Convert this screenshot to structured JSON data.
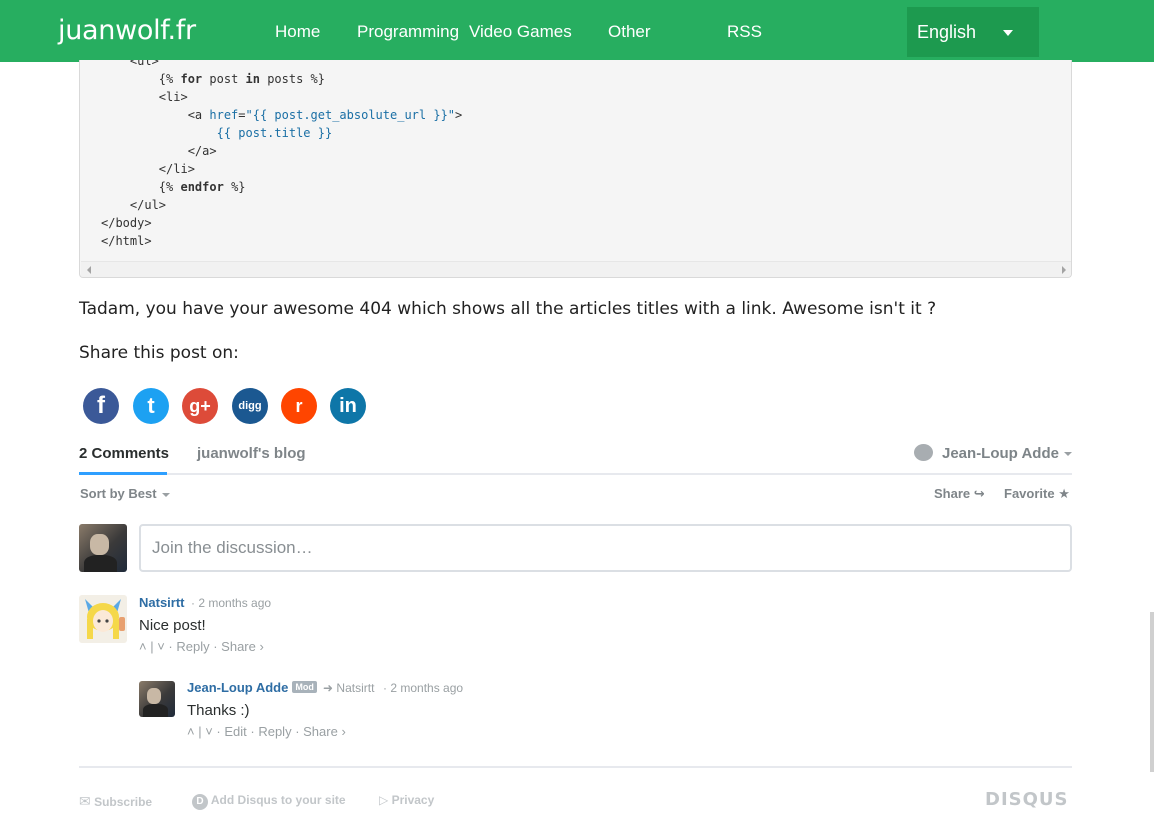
{
  "navbar": {
    "brand": "juanwolf.fr",
    "items": [
      {
        "label": "Home"
      },
      {
        "label": "Programming"
      },
      {
        "label": "Video Games"
      },
      {
        "label": "Other"
      },
      {
        "label": "RSS"
      }
    ],
    "language": "English"
  },
  "code_lines": [
    "    <ul>",
    "        {% for post in posts %}",
    "        <li>",
    "            <a href=\"{{ post.get_absolute_url }}\">",
    "                {{ post.title }}",
    "            </a>",
    "        </li>",
    "        {% endfor %}",
    "    </ul>",
    "</body>",
    "</html>"
  ],
  "article": {
    "text": "Tadam, you have your awesome 404 which shows all the articles titles with a link. Awesome isn't it ?",
    "share_heading": "Share this post on:"
  },
  "social": [
    {
      "name": "facebook",
      "glyph": "f",
      "color": "#3b5998"
    },
    {
      "name": "twitter",
      "glyph": "t",
      "color": "#1da1f2"
    },
    {
      "name": "google-plus",
      "glyph": "g+",
      "color": "#dd4b39"
    },
    {
      "name": "digg",
      "glyph": "digg",
      "color": "#1b5891"
    },
    {
      "name": "reddit",
      "glyph": "r",
      "color": "#ff4500"
    },
    {
      "name": "linkedin",
      "glyph": "in",
      "color": "#0e76a8"
    }
  ],
  "disqus": {
    "comments_tab": "2 Comments",
    "blog_tab": "juanwolf's blog",
    "user": "Jean-Loup Adde",
    "sort": "Sort by Best",
    "share": "Share",
    "favorite": "Favorite",
    "input_placeholder": "Join the discussion…",
    "comments": [
      {
        "author": "Natsirtt",
        "time": "2 months ago",
        "text": "Nice post!",
        "actions": [
          "Reply",
          "Share ›"
        ]
      },
      {
        "author": "Jean-Loup Adde",
        "badge": "Mod",
        "reply_to": "Natsirtt",
        "time": "2 months ago",
        "text": "Thanks :)",
        "actions": [
          "Edit",
          "Reply",
          "Share ›"
        ]
      }
    ],
    "footer": {
      "subscribe": "Subscribe",
      "add_disqus": "Add Disqus to your site",
      "privacy": "Privacy",
      "logo": "DISQUS"
    }
  }
}
